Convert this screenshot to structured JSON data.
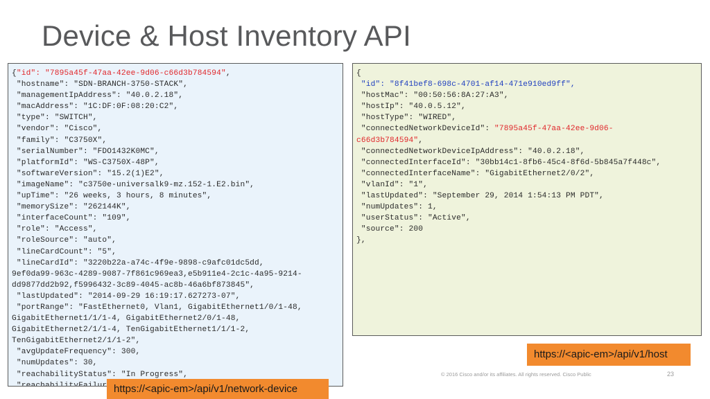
{
  "slide": {
    "title": "Device & Host Inventory API",
    "footer": "© 2016  Cisco and/or its affiliates. All rights reserved.   Cisco Public",
    "page_number": "23"
  },
  "device_json": {
    "lines": [
      {
        "parts": [
          {
            "t": "{",
            "c": ""
          },
          {
            "t": "\"id\": \"7895a45f-47aa-42ee-9d06-c66d3b784594\"",
            "c": "red"
          },
          {
            "t": ",",
            "c": ""
          }
        ]
      },
      {
        "parts": [
          {
            "t": " \"hostname\": \"SDN-BRANCH-3750-STACK\",",
            "c": ""
          }
        ]
      },
      {
        "parts": [
          {
            "t": " \"managementIpAddress\": \"40.0.2.18\",",
            "c": ""
          }
        ]
      },
      {
        "parts": [
          {
            "t": " \"macAddress\": \"1C:DF:0F:08:20:C2\",",
            "c": ""
          }
        ]
      },
      {
        "parts": [
          {
            "t": " \"type\": \"SWITCH\",",
            "c": ""
          }
        ]
      },
      {
        "parts": [
          {
            "t": " \"vendor\": \"Cisco\",",
            "c": ""
          }
        ]
      },
      {
        "parts": [
          {
            "t": " \"family\": \"C3750X\",",
            "c": ""
          }
        ]
      },
      {
        "parts": [
          {
            "t": " \"serialNumber\": \"FDO1432K0MC\",",
            "c": ""
          }
        ]
      },
      {
        "parts": [
          {
            "t": " \"platformId\": \"WS-C3750X-48P\",",
            "c": ""
          }
        ]
      },
      {
        "parts": [
          {
            "t": " \"softwareVersion\": \"15.2(1)E2\",",
            "c": ""
          }
        ]
      },
      {
        "parts": [
          {
            "t": " \"imageName\": \"c3750e-universalk9-mz.152-1.E2.bin\",",
            "c": ""
          }
        ]
      },
      {
        "parts": [
          {
            "t": " \"upTime\": \"26 weeks, 3 hours, 8 minutes\",",
            "c": ""
          }
        ]
      },
      {
        "parts": [
          {
            "t": " \"memorySize\": \"262144K\",",
            "c": ""
          }
        ]
      },
      {
        "parts": [
          {
            "t": " \"interfaceCount\": \"109\",",
            "c": ""
          }
        ]
      },
      {
        "parts": [
          {
            "t": " \"role\": \"Access\",",
            "c": ""
          }
        ]
      },
      {
        "parts": [
          {
            "t": " \"roleSource\": \"auto\",",
            "c": ""
          }
        ]
      },
      {
        "parts": [
          {
            "t": " \"lineCardCount\": \"5\",",
            "c": ""
          }
        ]
      },
      {
        "parts": [
          {
            "t": " \"lineCardId\": \"3220b22a-a74c-4f9e-9898-c9afc01dc5dd,",
            "c": ""
          }
        ]
      },
      {
        "parts": [
          {
            "t": "9ef0da99-963c-4289-9087-7f861c969ea3,e5b911e4-2c1c-4a95-9214-",
            "c": ""
          }
        ]
      },
      {
        "parts": [
          {
            "t": "dd9877dd2b92,f5996432-3c89-4045-ac8b-46a6bf873845\",",
            "c": ""
          }
        ]
      },
      {
        "parts": [
          {
            "t": " \"lastUpdated\": \"2014-09-29 16:19:17.627273-07\",",
            "c": ""
          }
        ]
      },
      {
        "parts": [
          {
            "t": " \"portRange\": \"FastEthernet0, Vlan1, GigabitEthernet1/0/1-48,",
            "c": ""
          }
        ]
      },
      {
        "parts": [
          {
            "t": "GigabitEthernet1/1/1-4, GigabitEthernet2/0/1-48,",
            "c": ""
          }
        ]
      },
      {
        "parts": [
          {
            "t": "GigabitEthernet2/1/1-4, TenGigabitEthernet1/1/1-2,",
            "c": ""
          }
        ]
      },
      {
        "parts": [
          {
            "t": "TenGigabitEthernet2/1/1-2\",",
            "c": ""
          }
        ]
      },
      {
        "parts": [
          {
            "t": " \"avgUpdateFrequency\": 300,",
            "c": ""
          }
        ]
      },
      {
        "parts": [
          {
            "t": " \"numUpdates\": 30,",
            "c": ""
          }
        ]
      },
      {
        "parts": [
          {
            "t": " \"reachabilityStatus\": \"In Progress\",",
            "c": ""
          }
        ]
      },
      {
        "parts": [
          {
            "t": " \"reachabilityFailureReason\": \"Unreachable\"",
            "c": ""
          }
        ]
      },
      {
        "parts": [
          {
            "t": "},",
            "c": ""
          }
        ]
      }
    ]
  },
  "host_json": {
    "lines": [
      {
        "parts": [
          {
            "t": "{",
            "c": ""
          }
        ]
      },
      {
        "parts": [
          {
            "t": " \"id\": \"8f41bef8-698c-4701-af14-471e910ed9ff\",",
            "c": "blue"
          }
        ]
      },
      {
        "parts": [
          {
            "t": " \"hostMac\": \"00:50:56:8A:27:A3\",",
            "c": ""
          }
        ]
      },
      {
        "parts": [
          {
            "t": " \"hostIp\": \"40.0.5.12\",",
            "c": ""
          }
        ]
      },
      {
        "parts": [
          {
            "t": " \"hostType\": \"WIRED\",",
            "c": ""
          }
        ]
      },
      {
        "parts": [
          {
            "t": " \"connectedNetworkDeviceId\": ",
            "c": ""
          },
          {
            "t": "\"7895a45f-47aa-42ee-9d06-",
            "c": "red"
          }
        ]
      },
      {
        "parts": [
          {
            "t": "c66d3b784594\"",
            "c": "red"
          },
          {
            "t": ",",
            "c": ""
          }
        ]
      },
      {
        "parts": [
          {
            "t": " \"connectedNetworkDeviceIpAddress\": \"40.0.2.18\",",
            "c": ""
          }
        ]
      },
      {
        "parts": [
          {
            "t": " \"connectedInterfaceId\": \"30bb14c1-8fb6-45c4-8f6d-5b845a7f448c\",",
            "c": ""
          }
        ]
      },
      {
        "parts": [
          {
            "t": " \"connectedInterfaceName\": \"GigabitEthernet2/0/2\",",
            "c": ""
          }
        ]
      },
      {
        "parts": [
          {
            "t": " \"vlanId\": \"1\",",
            "c": ""
          }
        ]
      },
      {
        "parts": [
          {
            "t": " \"lastUpdated\": \"September 29, 2014 1:54:13 PM PDT\",",
            "c": ""
          }
        ]
      },
      {
        "parts": [
          {
            "t": " \"numUpdates\": 1,",
            "c": ""
          }
        ]
      },
      {
        "parts": [
          {
            "t": " \"userStatus\": \"Active\",",
            "c": ""
          }
        ]
      },
      {
        "parts": [
          {
            "t": " \"source\": 200",
            "c": ""
          }
        ]
      },
      {
        "parts": [
          {
            "t": "},",
            "c": ""
          }
        ]
      }
    ]
  },
  "badges": {
    "device_url": "https://<apic-em>/api/v1/network-device",
    "host_url": "https://<apic-em>/api/v1/host"
  },
  "colors": {
    "badge": "#f28a2e",
    "device_panel": "#eaf3fb",
    "host_panel": "#eff3dc",
    "highlight_red": "#e0262a",
    "highlight_blue": "#1f3fbf"
  }
}
